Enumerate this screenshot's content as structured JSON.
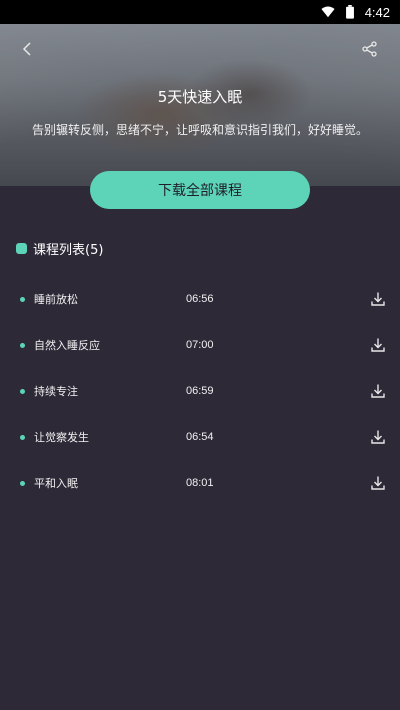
{
  "status_bar": {
    "time": "4:42",
    "icons": [
      "wifi-icon",
      "battery-icon"
    ]
  },
  "header": {
    "back_icon": "chevron-left-icon",
    "share_icon": "share-icon"
  },
  "hero": {
    "title": "5天快速入眠",
    "description": "告别辗转反侧，思绪不宁，让呼吸和意识指引我们，好好睡觉。"
  },
  "download_all": {
    "label": "下载全部课程"
  },
  "course_list": {
    "header": "课程列表(5)",
    "accent_color": "#5dd4b8",
    "items": [
      {
        "name": "睡前放松",
        "duration": "06:56",
        "icon": "download-icon"
      },
      {
        "name": "自然入睡反应",
        "duration": "07:00",
        "icon": "download-icon"
      },
      {
        "name": "持续专注",
        "duration": "06:59",
        "icon": "download-icon"
      },
      {
        "name": "让觉察发生",
        "duration": "06:54",
        "icon": "download-icon"
      },
      {
        "name": "平和入眠",
        "duration": "08:01",
        "icon": "download-icon"
      }
    ]
  },
  "colors": {
    "background": "#2d2937",
    "accent": "#5dd4b8"
  }
}
